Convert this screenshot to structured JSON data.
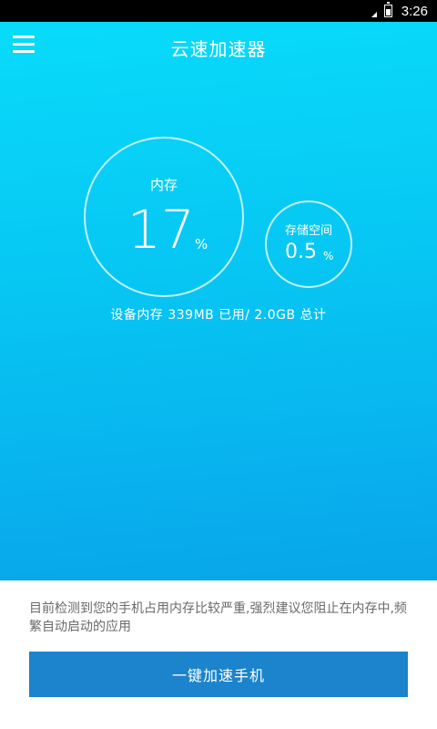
{
  "status_bar": {
    "time": "3:26",
    "icons": [
      "signal-icon",
      "battery-icon"
    ]
  },
  "app_bar": {
    "title": "云速加速器",
    "menu_icon": "hamburger-menu-icon"
  },
  "memory": {
    "label": "内存",
    "value": "17",
    "unit": "%"
  },
  "storage": {
    "label": "存储空间",
    "value": "0.5",
    "unit": "%"
  },
  "summary": "设备内存 339MB 已用/ 2.0GB 总计",
  "notice": "目前检测到您的手机占用内存比较严重,强烈建议您阻止在内存中,频繁自动启动的应用",
  "action_button": "一键加速手机",
  "colors": {
    "gradient_top": "#08dbfa",
    "gradient_bottom": "#08a5ea",
    "button": "#1b84cc",
    "notice_text": "#6a6a6a"
  }
}
